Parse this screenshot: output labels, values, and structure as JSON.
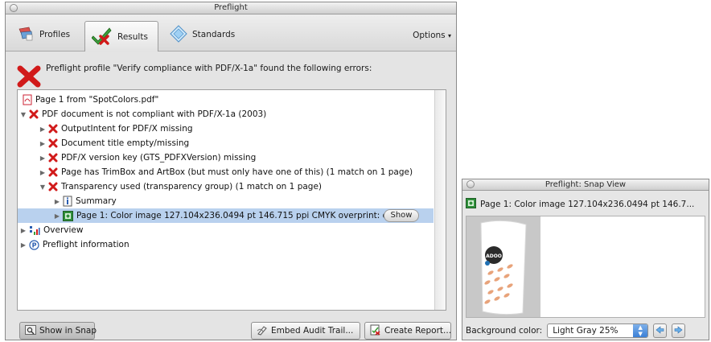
{
  "main_window": {
    "title": "Preflight",
    "tabs": [
      {
        "label": "Profiles",
        "icon": "profiles-icon"
      },
      {
        "label": "Results",
        "icon": "results-checkmark-icon",
        "selected": true
      },
      {
        "label": "Standards",
        "icon": "standards-diamond-icon"
      }
    ],
    "options_label": "Options",
    "message": "Preflight profile \"Verify compliance with PDF/X-1a\" found the following errors:",
    "tree": [
      {
        "label": "Page 1 from \"SpotColors.pdf\"",
        "icon": "pdf-icon",
        "indent": 0,
        "expander": "none"
      },
      {
        "label": "PDF document is not compliant with PDF/X-1a (2003)",
        "icon": "error-x-icon",
        "indent": 0,
        "expander": "open"
      },
      {
        "label": "OutputIntent for PDF/X missing",
        "icon": "error-x-icon",
        "indent": 1,
        "expander": "closed"
      },
      {
        "label": "Document title empty/missing",
        "icon": "error-x-icon",
        "indent": 1,
        "expander": "closed"
      },
      {
        "label": "PDF/X version key (GTS_PDFXVersion) missing",
        "icon": "error-x-icon",
        "indent": 1,
        "expander": "closed"
      },
      {
        "label": "Page has TrimBox and ArtBox (but must only have one of this) (1 match on 1 page)",
        "icon": "error-x-icon",
        "indent": 1,
        "expander": "closed"
      },
      {
        "label": "Transparency used (transparency group) (1 match on 1 page)",
        "icon": "error-x-icon",
        "indent": 1,
        "expander": "open"
      },
      {
        "label": "Summary",
        "icon": "info-icon",
        "indent": 2,
        "expander": "closed"
      },
      {
        "label": "Page 1: Color image 127.104x236.0494 pt 146.715 ppi CMYK  overprint: o",
        "icon": "image-icon",
        "indent": 2,
        "expander": "closed",
        "selected": true,
        "button": "Show"
      },
      {
        "label": "Overview",
        "icon": "overview-icon",
        "indent": 0,
        "expander": "closed"
      },
      {
        "label": "Preflight information",
        "icon": "preflight-info-icon",
        "indent": 0,
        "expander": "closed"
      }
    ],
    "buttons": {
      "show_in_snap": "Show in Snap",
      "embed_audit_trail": "Embed Audit Trail...",
      "create_report": "Create Report..."
    }
  },
  "snap_window": {
    "title": "Preflight: Snap View",
    "header": "Page 1: Color image 127.104x236.0494 pt 146.7...",
    "thumb_badge": "ADOO",
    "background_label": "Background color:",
    "background_value": "Light Gray 25%"
  },
  "colors": {
    "error_red": "#d11a1a",
    "selection_blue": "#b9d1ee",
    "accent_blue": "#3b7fd6"
  }
}
